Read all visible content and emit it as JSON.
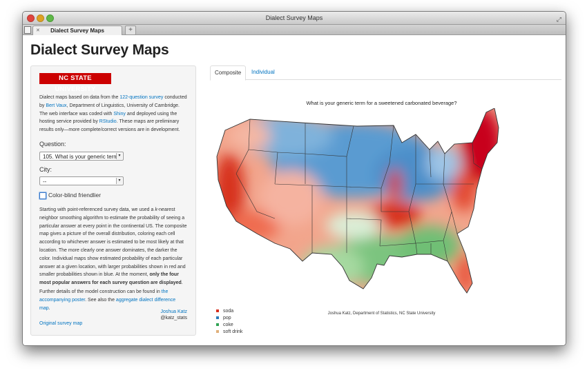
{
  "window": {
    "title": "Dialect Survey Maps",
    "tab_title": "Dialect Survey Maps"
  },
  "page": {
    "title": "Dialect Survey Maps"
  },
  "sidebar": {
    "logo_text": "NC STATE UNIVERSITY",
    "intro": {
      "t1": "Dialect maps based on data from the ",
      "link_survey": "122-question survey",
      "t2": " conducted by ",
      "link_vaux": "Bert Vaux",
      "t3": ", Department of Linguistics, University of Cambridge. The web interface was coded with ",
      "link_shiny": "Shiny",
      "t4": " and deployed using the hosting service provided by ",
      "link_rstudio": "RStudio",
      "t5": ". These maps are preliminary results only—more complete/correct versions are in development."
    },
    "question_label": "Question:",
    "question_value": "105. What is your generic term",
    "city_label": "City:",
    "city_value": "--",
    "colorblind_label": "Color-blind friendlier",
    "method": {
      "t1": "Starting with point-referenced survey data, we used a ",
      "k": "k",
      "t2": "-nearest neighbor smoothing algorithm to estimate the probability of seeing a particular answer at every point in the continental US. The composite map gives a picture of the overall distribution, coloring each cell according to whichever answer is estimated to be most likely at that location. The more clearly one answer dominates, the darker the color. Individual maps show estimated probability of each particular answer at a given location, with larger probabilities shown in red and smaller probabilities shown in blue. At the moment, ",
      "bold": "only the four most popular answers for each survey question are displayed",
      "t3": "."
    },
    "further": {
      "t1": "Further details of the model construction can be found in ",
      "link_poster": "the accompanying poster",
      "t2": ". See also the ",
      "link_agg": "aggregate dialect difference map",
      "t3": "."
    },
    "author_name": "Joshua Katz",
    "author_handle": "@katz_stats",
    "original_link": "Original survey map"
  },
  "tabs": [
    {
      "label": "Composite"
    },
    {
      "label": "Individual"
    }
  ],
  "map": {
    "title": "What is your generic term for a sweetened carbonated beverage?",
    "credit": "Joshua Katz, Department of Statistics, NC State University",
    "legend": [
      {
        "label": "soda",
        "color": "#d7301f"
      },
      {
        "label": "pop",
        "color": "#2b7bba"
      },
      {
        "label": "coke",
        "color": "#31a354"
      },
      {
        "label": "soft drink",
        "color": "#e0b07a"
      }
    ]
  },
  "colors": {
    "link": "#0073c0",
    "ncsu_red": "#cc0000"
  }
}
